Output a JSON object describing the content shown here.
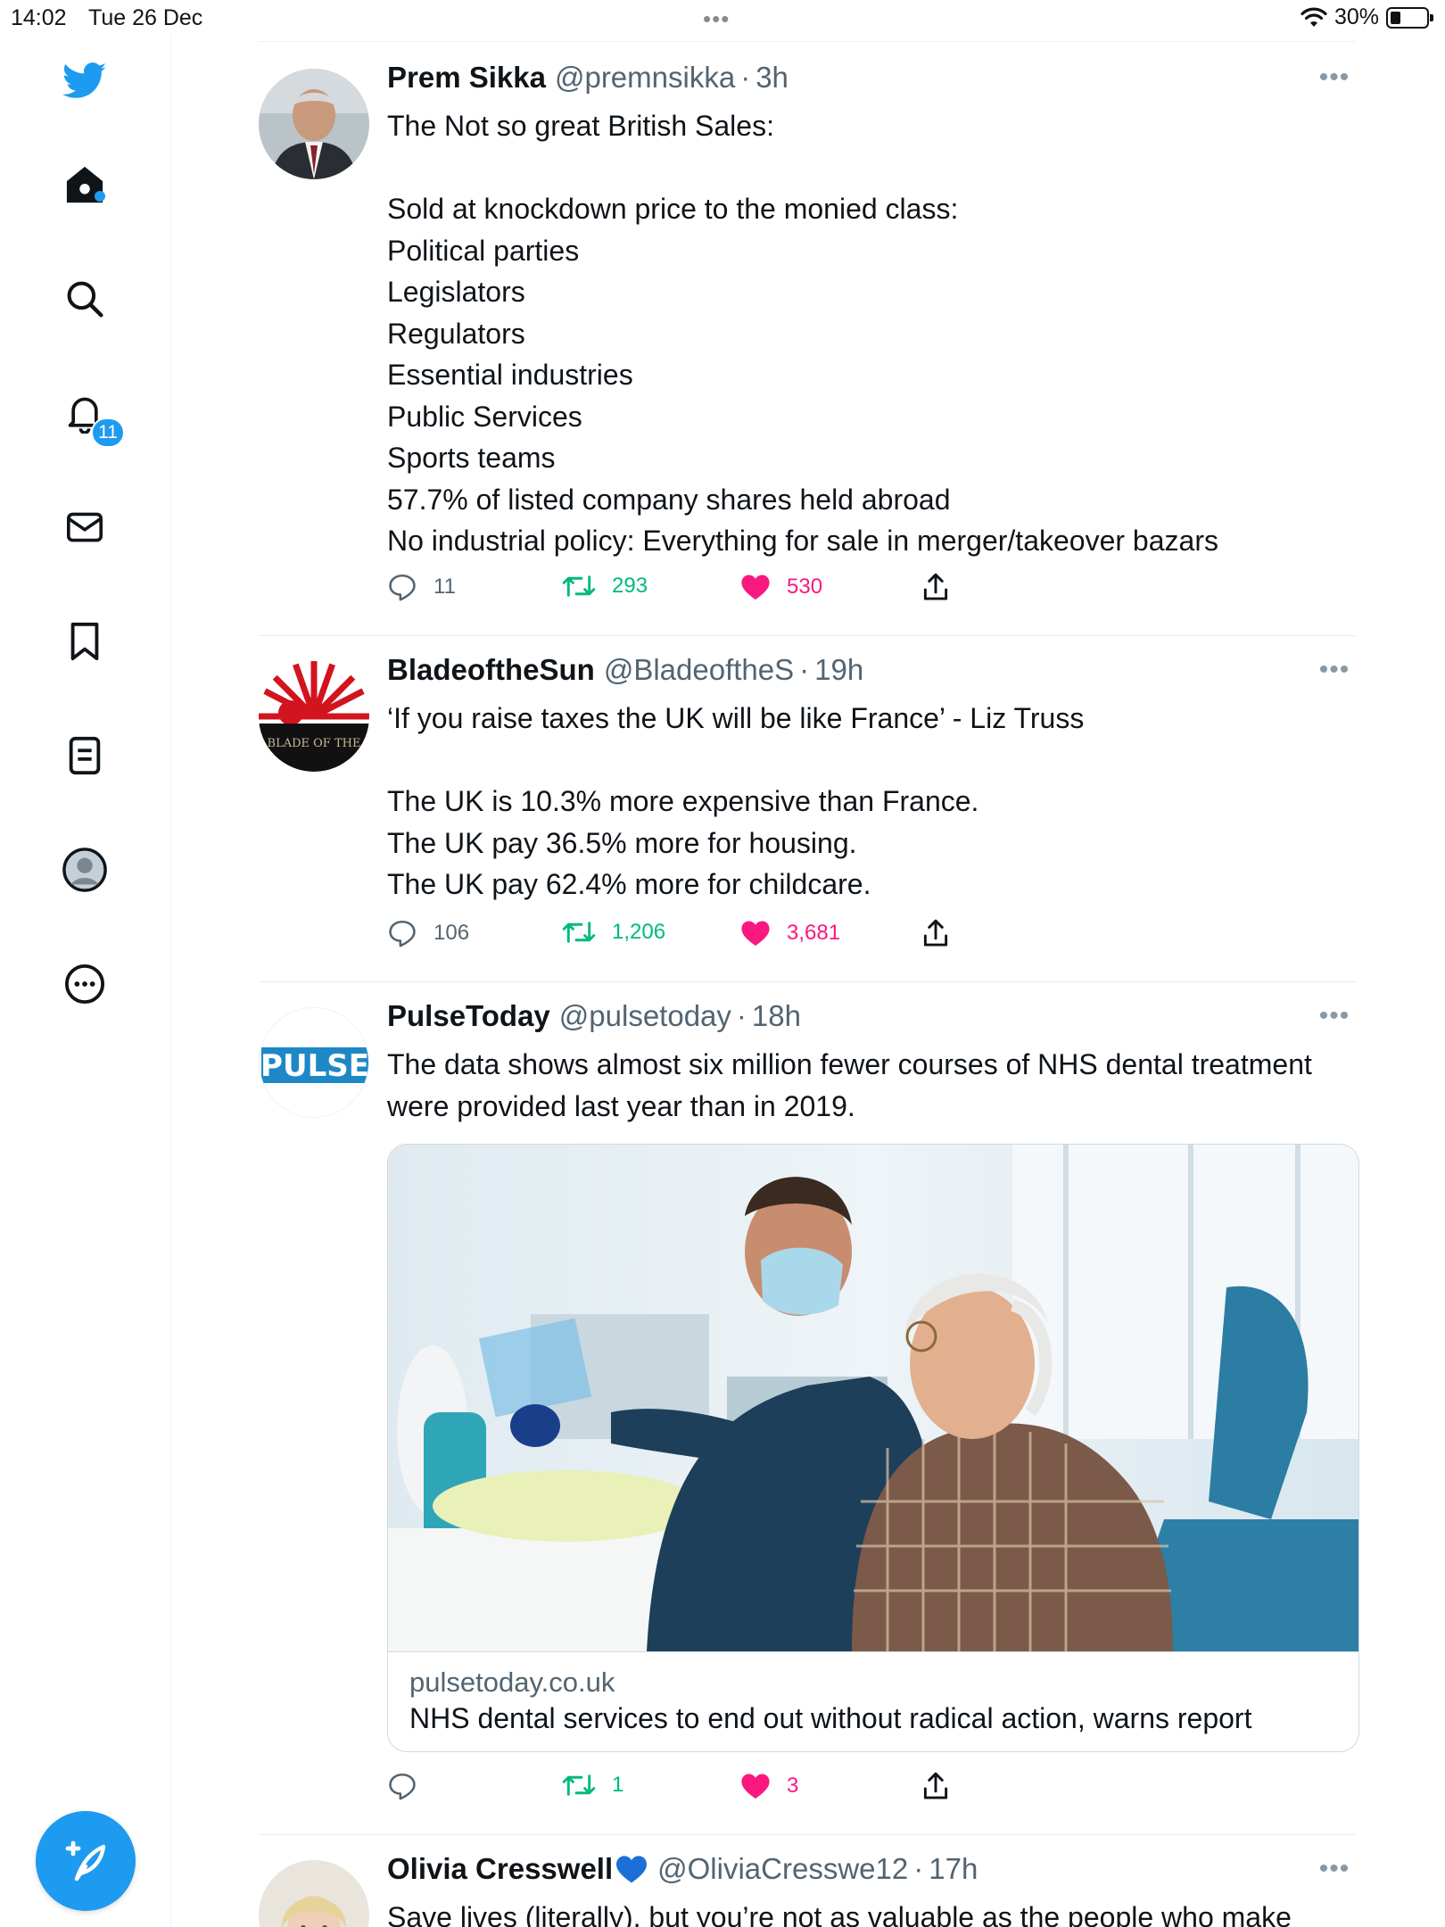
{
  "status_bar": {
    "time": "14:02",
    "date": "Tue 26 Dec",
    "battery": "30%"
  },
  "sidebar": {
    "notifications_badge": "11",
    "items": [
      "twitter-logo",
      "home",
      "search",
      "notifications",
      "messages",
      "bookmarks",
      "lists",
      "profile",
      "more"
    ]
  },
  "tweets": [
    {
      "name": "Prem Sikka",
      "handle": "@premnsikka",
      "time": "3h",
      "text": "The Not so great British Sales:\n\nSold at knockdown price to the monied class:\nPolitical parties\nLegislators\nRegulators\nEssential industries\nPublic Services\nSports teams\n57.7% of listed company shares held abroad\nNo industrial policy: Everything for sale in merger/takeover bazars",
      "replies": "11",
      "retweets": "293",
      "likes": "530"
    },
    {
      "name": "BladeoftheSun",
      "handle": "@BladeoftheS",
      "time": "19h",
      "avatar_text": "BLADE OF THE",
      "text": "‘If you raise taxes the UK will be like France’ - Liz Truss\n\nThe UK is 10.3% more expensive than France.\nThe UK pay 36.5% more for housing.\nThe UK pay 62.4% more for childcare.",
      "replies": "106",
      "retweets": "1,206",
      "likes": "3,681"
    },
    {
      "name": "PulseToday",
      "handle": "@pulsetoday",
      "time": "18h",
      "avatar_text": "PULSE",
      "text": "The data shows almost six million fewer courses of NHS dental treatment were provided last year than in 2019.",
      "card": {
        "domain": "pulsetoday.co.uk",
        "title": "NHS dental services to end out without radical action, warns report"
      },
      "replies": "",
      "retweets": "1",
      "likes": "3"
    },
    {
      "name": "Olivia Cresswell",
      "handle": "@OliviaCresswe12",
      "time": "17h",
      "text": "Save lives (literally), but you’re not as valuable as the people who make"
    }
  ],
  "colors": {
    "accent": "#1d9bf0",
    "retweet": "#00ba7c",
    "like": "#f91880",
    "muted": "#536471"
  }
}
